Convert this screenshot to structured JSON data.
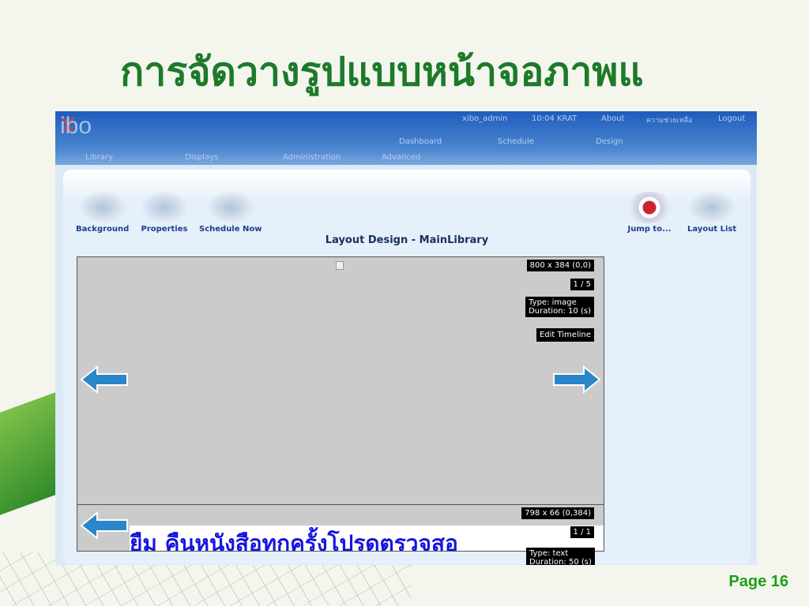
{
  "slide": {
    "title": "การจัดวางรูปแบบหน้าจอภาพแ",
    "page": "Page 16"
  },
  "header": {
    "logo_x": "X",
    "logo_rest": "ibo",
    "user": "xibo_admin",
    "time": "10:04 KRAT",
    "about": "About",
    "help": "ความช่วยเหลือ",
    "logout": "Logout",
    "nav_top": [
      "Dashboard",
      "Schedule",
      "Design"
    ],
    "nav_bottom": [
      "Library",
      "Displays",
      "Administration",
      "Advanced"
    ]
  },
  "toolbar": {
    "background": "Background",
    "properties": "Properties",
    "schedule_now": "Schedule Now",
    "jump_to": "Jump to...",
    "layout_list": "Layout List"
  },
  "layout_title": "Layout Design - MainLibrary",
  "region1": {
    "size": "800 x 384 (0,0)",
    "index": "1 / 5",
    "type": "Type: image",
    "duration": "Duration: 10 (s)",
    "edit": "Edit Timeline"
  },
  "region2": {
    "size": "798 x 66 (0,384)",
    "index": "1 / 1",
    "type": "Type: text",
    "duration": "Duration: 50 (s)",
    "ticker": "ยืม  คืนหนังสือทุกครั้งโปรดตรวจสอ"
  },
  "colors": {
    "accent": "#2a86c8",
    "title": "#1d7a2a"
  }
}
